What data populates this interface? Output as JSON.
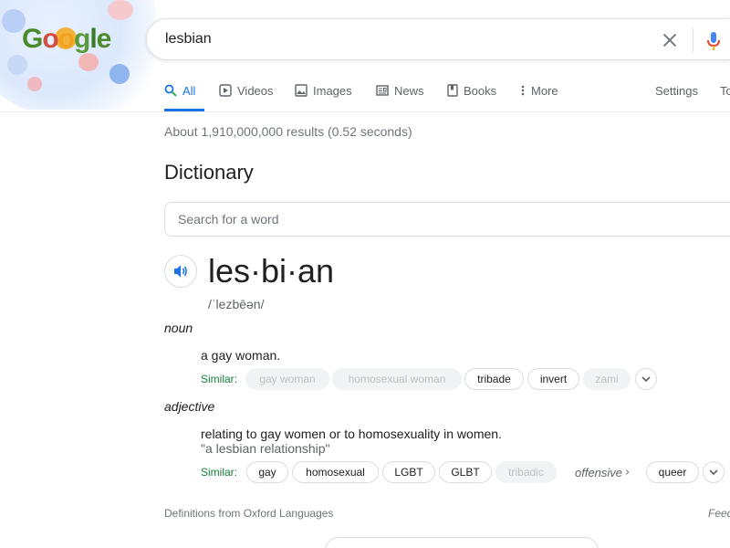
{
  "search": {
    "query": "lesbian"
  },
  "logo": {
    "text": "Google"
  },
  "tabs": [
    {
      "label": "All",
      "icon": "search-icon"
    },
    {
      "label": "Videos",
      "icon": "play-icon"
    },
    {
      "label": "Images",
      "icon": "image-icon"
    },
    {
      "label": "News",
      "icon": "news-icon"
    },
    {
      "label": "Books",
      "icon": "book-icon"
    },
    {
      "label": "More",
      "icon": "more-vert-icon"
    }
  ],
  "tools": {
    "settings": "Settings",
    "tools_partial": "To"
  },
  "result_stats": "About 1,910,000,000 results (0.52 seconds)",
  "dictionary": {
    "title": "Dictionary",
    "search_placeholder": "Search for a word",
    "headword": "les·bi·an",
    "phonetic": "/ˈlezbēən/",
    "noun": {
      "pos": "noun",
      "definition": "a gay woman.",
      "similar_label": "Similar:",
      "similar": [
        "gay woman",
        "homosexual woman",
        "tribade",
        "invert",
        "zami"
      ]
    },
    "adjective": {
      "pos": "adjective",
      "definition": "relating to gay women or to homosexuality in women.",
      "example": "\"a lesbian relationship\"",
      "similar_label": "Similar:",
      "similar": [
        "gay",
        "homosexual",
        "LGBT",
        "GLBT",
        "tribadic",
        "offensive",
        "queer"
      ]
    },
    "source": "Definitions from Oxford Languages",
    "feedback": "Feed"
  },
  "colors": {
    "accent": "#1a73e8",
    "similar_green": "#188038"
  }
}
